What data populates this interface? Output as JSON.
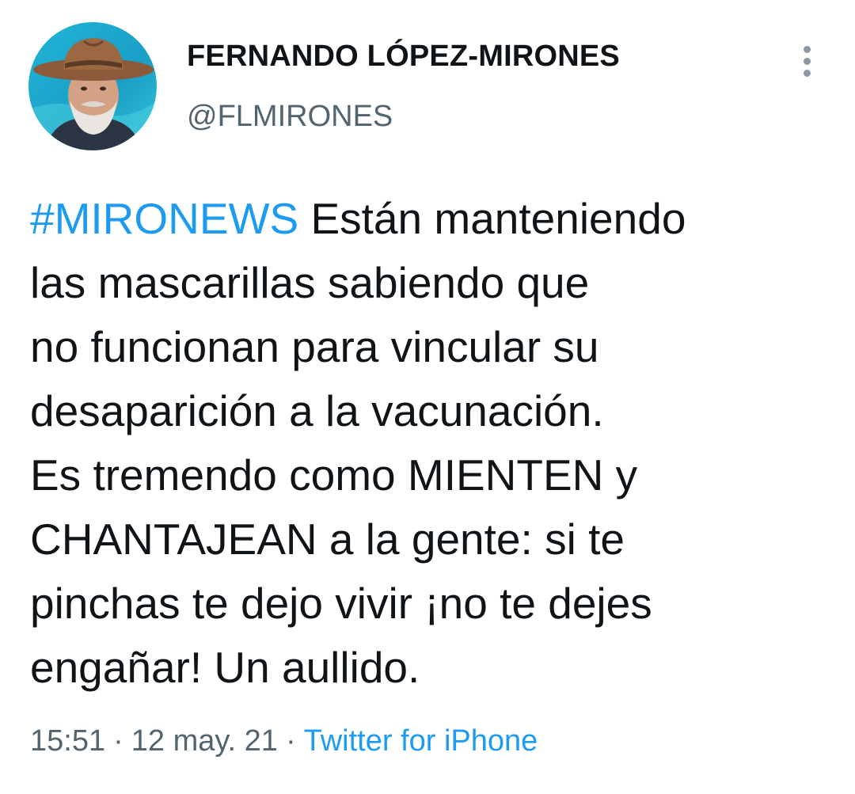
{
  "author": {
    "display_name": "FERNANDO LÓPEZ-MIRONES",
    "handle": "@FLMIRONES",
    "avatar_icon": "profile-photo"
  },
  "more_icon": "more-vertical-icon",
  "tweet": {
    "hashtag": "#MIRONEWS",
    "lines": [
      " Están manteniendo",
      "las mascarillas sabiendo que",
      "no funcionan para vincular su",
      "desaparición a la vacunación.",
      "Es tremendo como MIENTEN y",
      "CHANTAJEAN a la gente: si te",
      "pinchas te dejo vivir ¡no te dejes",
      "engañar! Un aullido."
    ]
  },
  "meta": {
    "time": "15:51",
    "separator": "·",
    "date": "12 may. 21",
    "source": "Twitter for iPhone"
  },
  "colors": {
    "link": "#1d9bf0",
    "text": "#0f1419",
    "secondary": "#536471"
  }
}
